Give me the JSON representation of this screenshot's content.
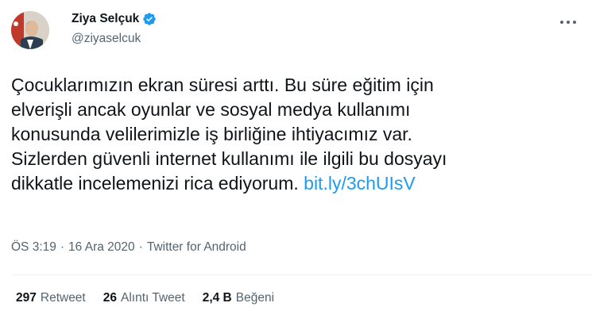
{
  "user": {
    "display_name": "Ziya Selçuk",
    "handle": "@ziyaselcuk",
    "verified": true
  },
  "tweet": {
    "text": "Çocuklarımızın ekran süresi arttı. Bu süre eğitim için\nelverişli ancak oyunlar ve sosyal medya kullanımı\nkonusunda velilerimizle iş birliğine ihtiyacımız var.\nSizlerden güvenli internet kullanımı ile ilgili bu dosyayı\ndikkatle incelemenizi rica ediyorum. ",
    "link": "bit.ly/3chUIsV"
  },
  "meta": {
    "time": "ÖS 3:19",
    "separator": "·",
    "date": "16 Ara 2020",
    "source": "Twitter for Android"
  },
  "stats": [
    {
      "count": "297",
      "label": "Retweet"
    },
    {
      "count": "26",
      "label": "Alıntı Tweet"
    },
    {
      "count": "2,4 B",
      "label": "Beğeni"
    }
  ],
  "colors": {
    "link": "#1d9bf0",
    "verified_badge": "#1d9bf0",
    "secondary_text": "#536471"
  },
  "icons": {
    "verified": "verified-badge-icon",
    "more": "more-options-icon"
  }
}
